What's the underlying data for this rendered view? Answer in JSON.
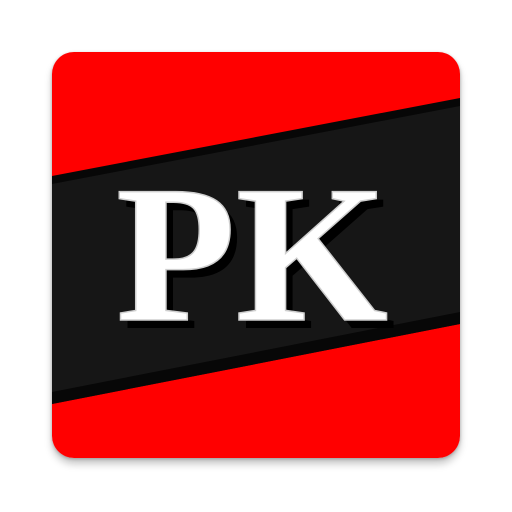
{
  "logo": {
    "text": "PK",
    "colors": {
      "background_red": "#ff0000",
      "band_black": "#141414",
      "band_edge": "#050505",
      "letter_fill": "#ffffff",
      "letter_shadow": "#000000",
      "letter_outline": "#cfcfcf"
    }
  }
}
